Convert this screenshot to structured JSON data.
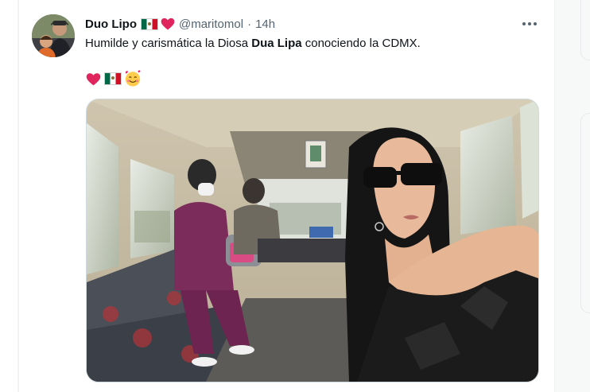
{
  "tweet": {
    "display_name": "Duo Lipo",
    "handle": "@maritomol",
    "separator": "·",
    "time": "14h",
    "text_before": "Humilde y carismática la Diosa ",
    "text_bold": "Dua Lipa",
    "text_after": " conociendo la CDMX.",
    "name_emojis": [
      "mexico-flag-icon",
      "heart-icon"
    ],
    "emoji_line": [
      "heart-icon",
      "mexico-flag-icon",
      "smiling-face-with-hearts-icon"
    ],
    "media_description": "Dua Lipa selfie inside a public minibus in CDMX"
  },
  "colors": {
    "text": "#0f1419",
    "secondary": "#536471",
    "heart": "#e0245e",
    "border": "#eff3f4"
  }
}
